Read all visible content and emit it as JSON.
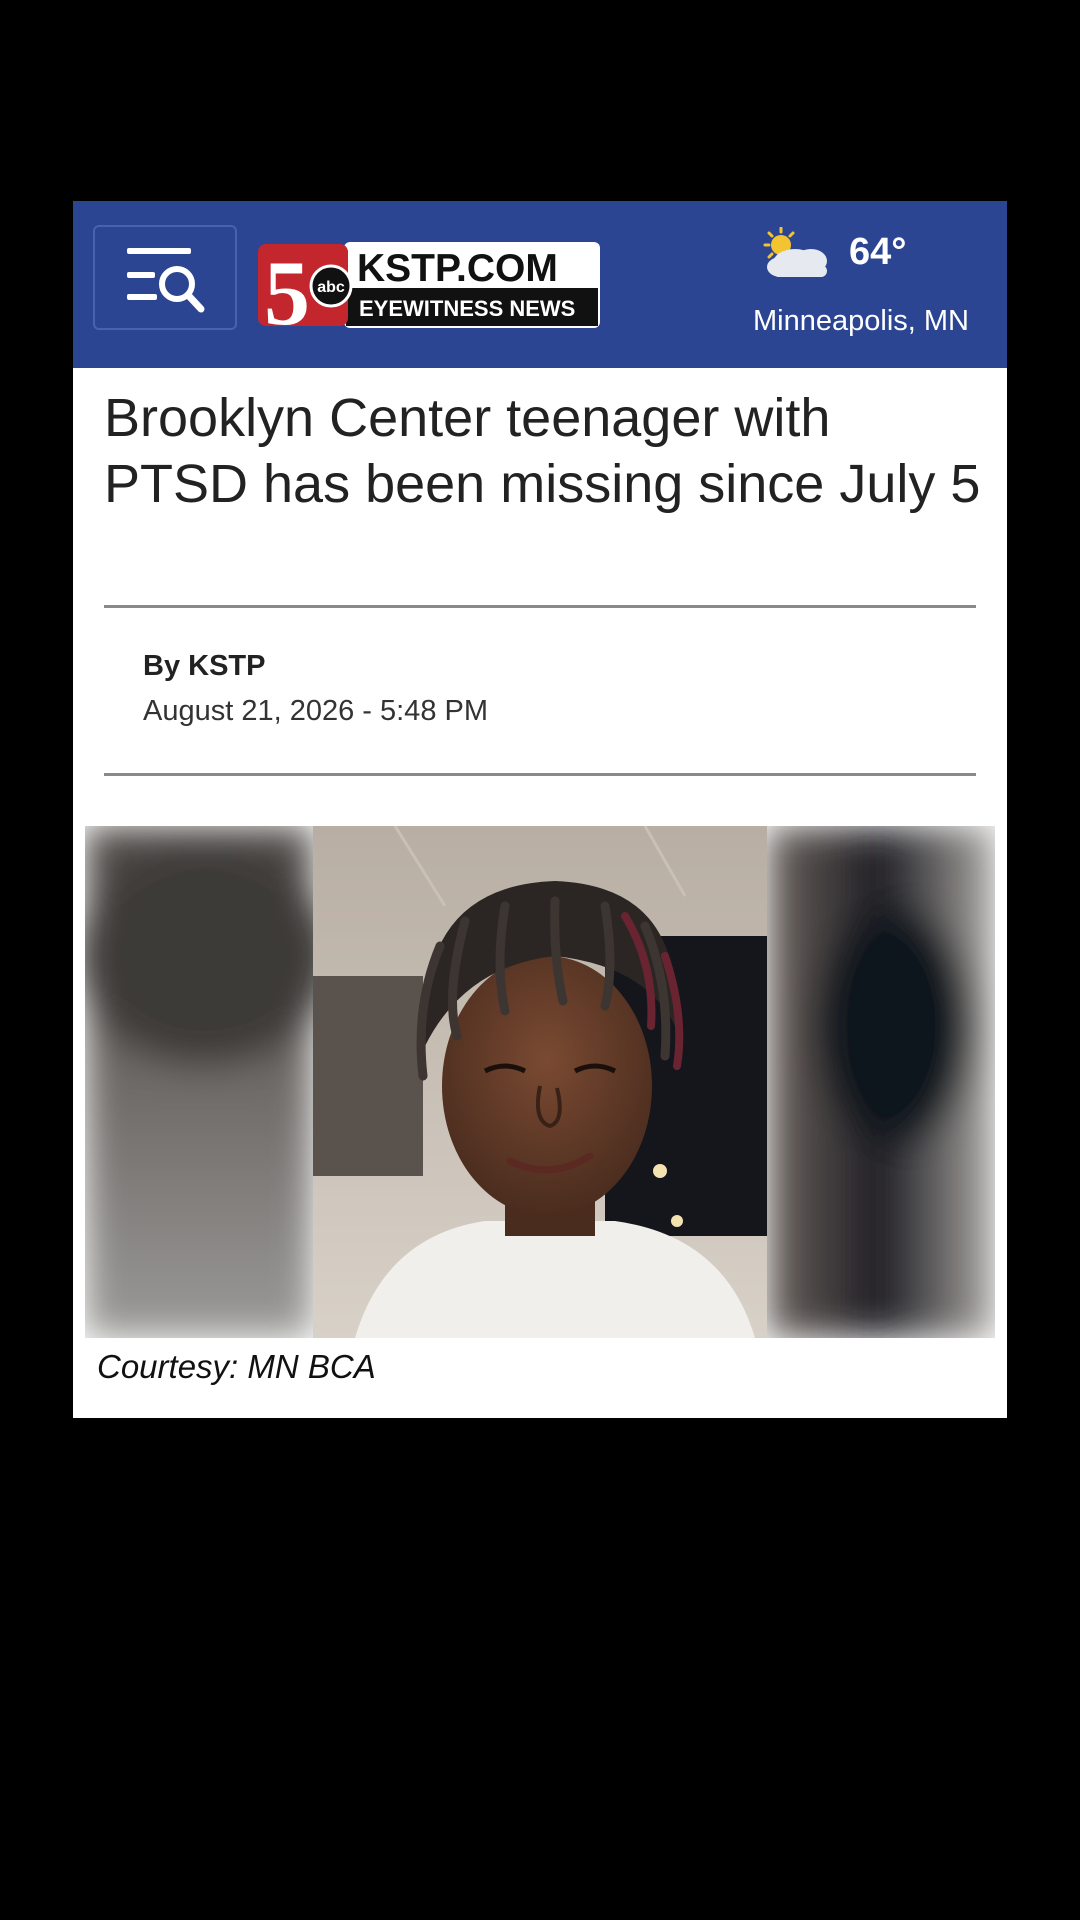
{
  "colors": {
    "brand": "#2b4592",
    "logo_red": "#c4262e",
    "logo_dark": "#111111",
    "page_background": "#000000"
  },
  "header": {
    "menu_icon": "search-menu-icon",
    "logo": {
      "numeral": "5",
      "network": "abc",
      "site": "KSTP.COM",
      "tagline": "EYEWITNESS NEWS"
    },
    "weather": {
      "icon": "partly-cloudy-icon",
      "temperature": "64°",
      "location": "Minneapolis, MN"
    }
  },
  "article": {
    "headline": "Brooklyn Center teenager with PTSD has been missing since July 5",
    "byline": "By KSTP",
    "date": "August 21, 2026 - 5:48 PM",
    "image_caption": "Courtesy: MN BCA"
  }
}
